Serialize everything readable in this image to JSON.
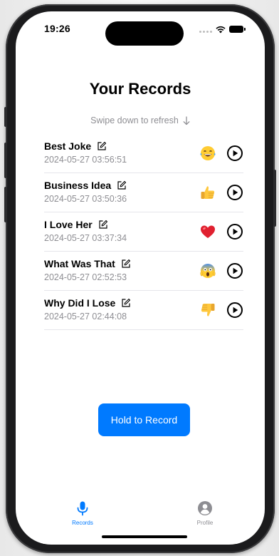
{
  "status_bar": {
    "time": "19:26",
    "icons": [
      "signal-dots-icon",
      "wifi-icon",
      "battery-icon"
    ]
  },
  "header": {
    "title": "Your Records"
  },
  "refresh_hint": {
    "text": "Swipe down to refresh",
    "icon": "arrow-down-icon"
  },
  "records": [
    {
      "name": "Best Joke",
      "date": "2024-05-27 03:56:51",
      "reaction": "laughing-emoji"
    },
    {
      "name": "Business Idea",
      "date": "2024-05-27 03:50:36",
      "reaction": "thumbs-up-emoji"
    },
    {
      "name": "I Love Her",
      "date": "2024-05-27 03:37:34",
      "reaction": "red-heart-emoji"
    },
    {
      "name": "What Was That",
      "date": "2024-05-27 02:52:53",
      "reaction": "screaming-face-emoji"
    },
    {
      "name": "Why Did I Lose",
      "date": "2024-05-27 02:44:08",
      "reaction": "thumbs-down-emoji"
    }
  ],
  "record_button": {
    "label": "Hold to Record"
  },
  "tab_bar": {
    "tabs": [
      {
        "label": "Records",
        "icon": "microphone-icon",
        "selected": true
      },
      {
        "label": "Profile",
        "icon": "person-circle-icon",
        "selected": false
      }
    ]
  },
  "colors": {
    "accent": "#007aff",
    "secondary_text": "#8e8e93",
    "inactive_tab": "#8e8e93",
    "separator": "#e5e5ea"
  }
}
